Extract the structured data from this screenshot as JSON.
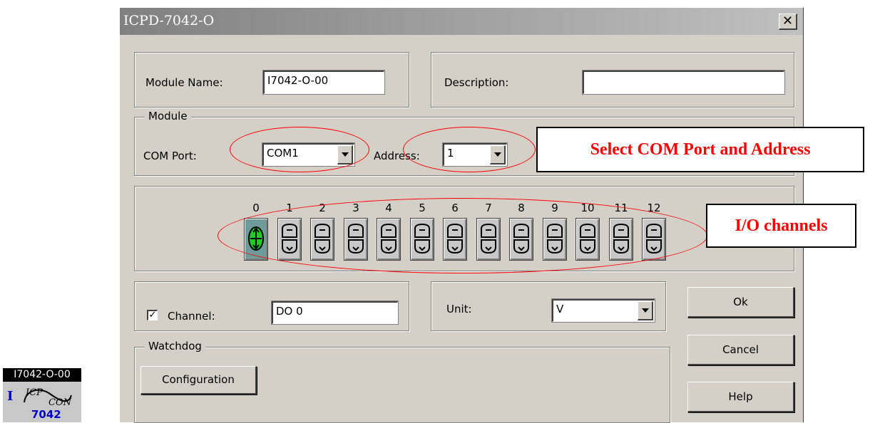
{
  "window": {
    "title": "ICPD-7042-O"
  },
  "module_name": {
    "label": "Module Name:",
    "value": "I7042-O-00"
  },
  "description": {
    "label": "Description:",
    "value": ""
  },
  "module_group": {
    "legend": "Module",
    "com_port_label": "COM Port:",
    "com_port_value": "COM1",
    "address_label": "Address:",
    "address_value": "1"
  },
  "channels": [
    "0",
    "1",
    "2",
    "3",
    "4",
    "5",
    "6",
    "7",
    "8",
    "9",
    "10",
    "11",
    "12"
  ],
  "channel_field": {
    "label": "Channel:",
    "checked": true,
    "value": "DO 0"
  },
  "unit": {
    "label": "Unit:",
    "value": "V"
  },
  "watchdog": {
    "legend": "Watchdog",
    "config_button": "Configuration"
  },
  "buttons": {
    "ok": "Ok",
    "cancel": "Cancel",
    "help": "Help"
  },
  "callouts": {
    "com_address": "Select COM Port and Address",
    "io_channels": "I/O channels"
  },
  "module_icon": {
    "caption": "I7042-O-00",
    "number": "7042",
    "letter": "I",
    "logo_text": "ICP CON"
  },
  "colors": {
    "annotation": "#ff0000",
    "active_channel": "#6f9a9a",
    "dialog_bg": "#d4d0c8"
  }
}
